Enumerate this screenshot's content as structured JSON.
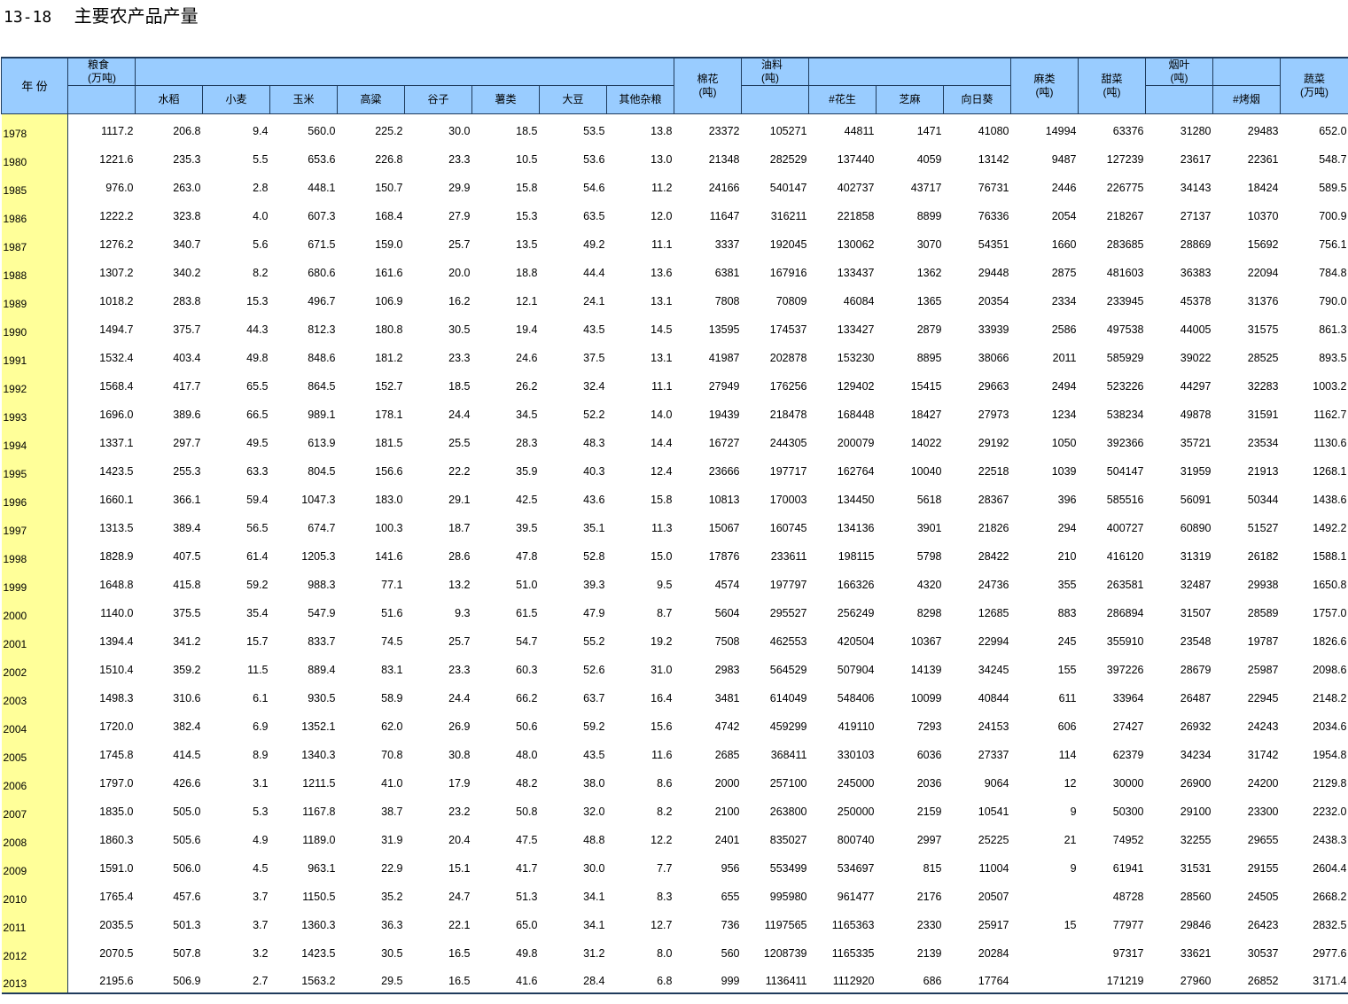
{
  "title": {
    "code": "13-18",
    "text": "主要农产品产量"
  },
  "header": {
    "year": "年  份",
    "grain": {
      "name": "粮食",
      "unit": "(万吨)"
    },
    "grain_subs": [
      "水稻",
      "小麦",
      "玉米",
      "高粱",
      "谷子",
      "薯类",
      "大豆",
      "其他杂粮"
    ],
    "cotton": {
      "name": "棉花",
      "unit": "(吨)"
    },
    "oil": {
      "name": "油料",
      "unit": "(吨)"
    },
    "oil_subs": [
      "#花生",
      "芝麻",
      "向日葵"
    ],
    "hemp": {
      "name": "麻类",
      "unit": "(吨)"
    },
    "beet": {
      "name": "甜菜",
      "unit": "(吨)"
    },
    "tobacco": {
      "name": "烟叶",
      "unit": "(吨)"
    },
    "tobacco_subs": [
      "#烤烟"
    ],
    "veg": {
      "name": "蔬菜",
      "unit": "(万吨)"
    }
  },
  "rows": [
    [
      "1978",
      "1117.2",
      "206.8",
      "9.4",
      "560.0",
      "225.2",
      "30.0",
      "18.5",
      "53.5",
      "13.8",
      "23372",
      "105271",
      "44811",
      "1471",
      "41080",
      "14994",
      "63376",
      "31280",
      "29483",
      "652.0"
    ],
    [
      "1980",
      "1221.6",
      "235.3",
      "5.5",
      "653.6",
      "226.8",
      "23.3",
      "10.5",
      "53.6",
      "13.0",
      "21348",
      "282529",
      "137440",
      "4059",
      "13142",
      "9487",
      "127239",
      "23617",
      "22361",
      "548.7"
    ],
    [
      "1985",
      "976.0",
      "263.0",
      "2.8",
      "448.1",
      "150.7",
      "29.9",
      "15.8",
      "54.6",
      "11.2",
      "24166",
      "540147",
      "402737",
      "43717",
      "76731",
      "2446",
      "226775",
      "34143",
      "18424",
      "589.5"
    ],
    [
      "1986",
      "1222.2",
      "323.8",
      "4.0",
      "607.3",
      "168.4",
      "27.9",
      "15.3",
      "63.5",
      "12.0",
      "11647",
      "316211",
      "221858",
      "8899",
      "76336",
      "2054",
      "218267",
      "27137",
      "10370",
      "700.9"
    ],
    [
      "1987",
      "1276.2",
      "340.7",
      "5.6",
      "671.5",
      "159.0",
      "25.7",
      "13.5",
      "49.2",
      "11.1",
      "3337",
      "192045",
      "130062",
      "3070",
      "54351",
      "1660",
      "283685",
      "28869",
      "15692",
      "756.1"
    ],
    [
      "1988",
      "1307.2",
      "340.2",
      "8.2",
      "680.6",
      "161.6",
      "20.0",
      "18.8",
      "44.4",
      "13.6",
      "6381",
      "167916",
      "133437",
      "1362",
      "29448",
      "2875",
      "481603",
      "36383",
      "22094",
      "784.8"
    ],
    [
      "1989",
      "1018.2",
      "283.8",
      "15.3",
      "496.7",
      "106.9",
      "16.2",
      "12.1",
      "24.1",
      "13.1",
      "7808",
      "70809",
      "46084",
      "1365",
      "20354",
      "2334",
      "233945",
      "45378",
      "31376",
      "790.0"
    ],
    [
      "1990",
      "1494.7",
      "375.7",
      "44.3",
      "812.3",
      "180.8",
      "30.5",
      "19.4",
      "43.5",
      "14.5",
      "13595",
      "174537",
      "133427",
      "2879",
      "33939",
      "2586",
      "497538",
      "44005",
      "31575",
      "861.3"
    ],
    [
      "1991",
      "1532.4",
      "403.4",
      "49.8",
      "848.6",
      "181.2",
      "23.3",
      "24.6",
      "37.5",
      "13.1",
      "41987",
      "202878",
      "153230",
      "8895",
      "38066",
      "2011",
      "585929",
      "39022",
      "28525",
      "893.5"
    ],
    [
      "1992",
      "1568.4",
      "417.7",
      "65.5",
      "864.5",
      "152.7",
      "18.5",
      "26.2",
      "32.4",
      "11.1",
      "27949",
      "176256",
      "129402",
      "15415",
      "29663",
      "2494",
      "523226",
      "44297",
      "32283",
      "1003.2"
    ],
    [
      "1993",
      "1696.0",
      "389.6",
      "66.5",
      "989.1",
      "178.1",
      "24.4",
      "34.5",
      "52.2",
      "14.0",
      "19439",
      "218478",
      "168448",
      "18427",
      "27973",
      "1234",
      "538234",
      "49878",
      "31591",
      "1162.7"
    ],
    [
      "1994",
      "1337.1",
      "297.7",
      "49.5",
      "613.9",
      "181.5",
      "25.5",
      "28.3",
      "48.3",
      "14.4",
      "16727",
      "244305",
      "200079",
      "14022",
      "29192",
      "1050",
      "392366",
      "35721",
      "23534",
      "1130.6"
    ],
    [
      "1995",
      "1423.5",
      "255.3",
      "63.3",
      "804.5",
      "156.6",
      "22.2",
      "35.9",
      "40.3",
      "12.4",
      "23666",
      "197717",
      "162764",
      "10040",
      "22518",
      "1039",
      "504147",
      "31959",
      "21913",
      "1268.1"
    ],
    [
      "1996",
      "1660.1",
      "366.1",
      "59.4",
      "1047.3",
      "183.0",
      "29.1",
      "42.5",
      "43.6",
      "15.8",
      "10813",
      "170003",
      "134450",
      "5618",
      "28367",
      "396",
      "585516",
      "56091",
      "50344",
      "1438.6"
    ],
    [
      "1997",
      "1313.5",
      "389.4",
      "56.5",
      "674.7",
      "100.3",
      "18.7",
      "39.5",
      "35.1",
      "11.3",
      "15067",
      "160745",
      "134136",
      "3901",
      "21826",
      "294",
      "400727",
      "60890",
      "51527",
      "1492.2"
    ],
    [
      "1998",
      "1828.9",
      "407.5",
      "61.4",
      "1205.3",
      "141.6",
      "28.6",
      "47.8",
      "52.8",
      "15.0",
      "17876",
      "233611",
      "198115",
      "5798",
      "28422",
      "210",
      "416120",
      "31319",
      "26182",
      "1588.1"
    ],
    [
      "1999",
      "1648.8",
      "415.8",
      "59.2",
      "988.3",
      "77.1",
      "13.2",
      "51.0",
      "39.3",
      "9.5",
      "4574",
      "197797",
      "166326",
      "4320",
      "24736",
      "355",
      "263581",
      "32487",
      "29938",
      "1650.8"
    ],
    [
      "2000",
      "1140.0",
      "375.5",
      "35.4",
      "547.9",
      "51.6",
      "9.3",
      "61.5",
      "47.9",
      "8.7",
      "5604",
      "295527",
      "256249",
      "8298",
      "12685",
      "883",
      "286894",
      "31507",
      "28589",
      "1757.0"
    ],
    [
      "2001",
      "1394.4",
      "341.2",
      "15.7",
      "833.7",
      "74.5",
      "25.7",
      "54.7",
      "55.2",
      "19.2",
      "7508",
      "462553",
      "420504",
      "10367",
      "22994",
      "245",
      "355910",
      "23548",
      "19787",
      "1826.6"
    ],
    [
      "2002",
      "1510.4",
      "359.2",
      "11.5",
      "889.4",
      "83.1",
      "23.3",
      "60.3",
      "52.6",
      "31.0",
      "2983",
      "564529",
      "507904",
      "14139",
      "34245",
      "155",
      "397226",
      "28679",
      "25987",
      "2098.6"
    ],
    [
      "2003",
      "1498.3",
      "310.6",
      "6.1",
      "930.5",
      "58.9",
      "24.4",
      "66.2",
      "63.7",
      "16.4",
      "3481",
      "614049",
      "548406",
      "10099",
      "40844",
      "611",
      "33964",
      "26487",
      "22945",
      "2148.2"
    ],
    [
      "2004",
      "1720.0",
      "382.4",
      "6.9",
      "1352.1",
      "62.0",
      "26.9",
      "50.6",
      "59.2",
      "15.6",
      "4742",
      "459299",
      "419110",
      "7293",
      "24153",
      "606",
      "27427",
      "26932",
      "24243",
      "2034.6"
    ],
    [
      "2005",
      "1745.8",
      "414.5",
      "8.9",
      "1340.3",
      "70.8",
      "30.8",
      "48.0",
      "43.5",
      "11.6",
      "2685",
      "368411",
      "330103",
      "6036",
      "27337",
      "114",
      "62379",
      "34234",
      "31742",
      "1954.8"
    ],
    [
      "2006",
      "1797.0",
      "426.6",
      "3.1",
      "1211.5",
      "41.0",
      "17.9",
      "48.2",
      "38.0",
      "8.6",
      "2000",
      "257100",
      "245000",
      "2036",
      "9064",
      "12",
      "30000",
      "26900",
      "24200",
      "2129.8"
    ],
    [
      "2007",
      "1835.0",
      "505.0",
      "5.3",
      "1167.8",
      "38.7",
      "23.2",
      "50.8",
      "32.0",
      "8.2",
      "2100",
      "263800",
      "250000",
      "2159",
      "10541",
      "9",
      "50300",
      "29100",
      "23300",
      "2232.0"
    ],
    [
      "2008",
      "1860.3",
      "505.6",
      "4.9",
      "1189.0",
      "31.9",
      "20.4",
      "47.5",
      "48.8",
      "12.2",
      "2401",
      "835027",
      "800740",
      "2997",
      "25225",
      "21",
      "74952",
      "32255",
      "29655",
      "2438.3"
    ],
    [
      "2009",
      "1591.0",
      "506.0",
      "4.5",
      "963.1",
      "22.9",
      "15.1",
      "41.7",
      "30.0",
      "7.7",
      "956",
      "553499",
      "534697",
      "815",
      "11004",
      "9",
      "61941",
      "31531",
      "29155",
      "2604.4"
    ],
    [
      "2010",
      "1765.4",
      "457.6",
      "3.7",
      "1150.5",
      "35.2",
      "24.7",
      "51.3",
      "34.1",
      "8.3",
      "655",
      "995980",
      "961477",
      "2176",
      "20507",
      "",
      "48728",
      "28560",
      "24505",
      "2668.2"
    ],
    [
      "2011",
      "2035.5",
      "501.3",
      "3.7",
      "1360.3",
      "36.3",
      "22.1",
      "65.0",
      "34.1",
      "12.7",
      "736",
      "1197565",
      "1165363",
      "2330",
      "25917",
      "15",
      "77977",
      "29846",
      "26423",
      "2832.5"
    ],
    [
      "2012",
      "2070.5",
      "507.8",
      "3.2",
      "1423.5",
      "30.5",
      "16.5",
      "49.8",
      "31.2",
      "8.0",
      "560",
      "1208739",
      "1165335",
      "2139",
      "20284",
      "",
      "97317",
      "33621",
      "30537",
      "2977.6"
    ],
    [
      "2013",
      "2195.6",
      "506.9",
      "2.7",
      "1563.2",
      "29.5",
      "16.5",
      "41.6",
      "28.4",
      "6.8",
      "999",
      "1136411",
      "1112920",
      "686",
      "17764",
      "",
      "171219",
      "27960",
      "26852",
      "3171.4"
    ]
  ]
}
